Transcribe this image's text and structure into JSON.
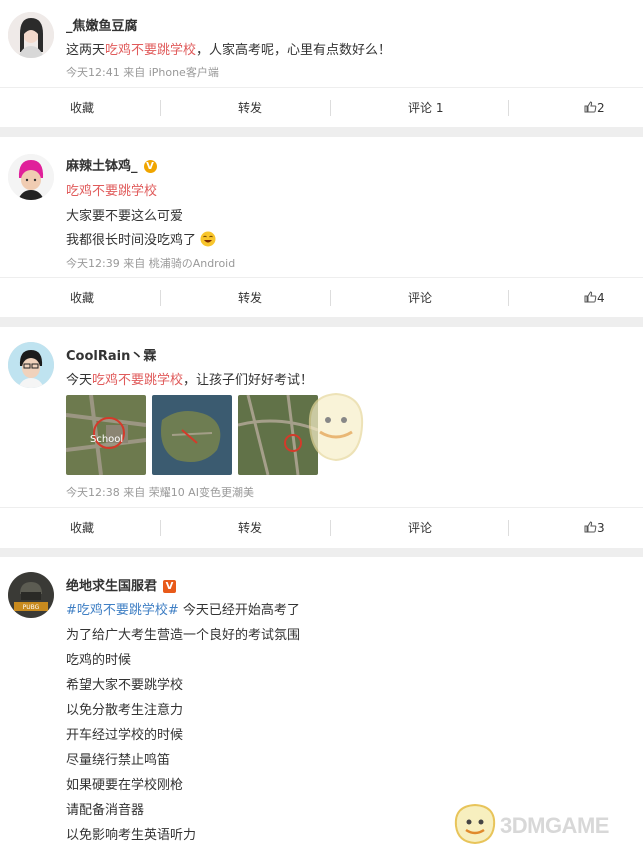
{
  "posts": [
    {
      "username": "_焦嫩鱼豆腐",
      "verified": false,
      "lines": [
        {
          "pre": "这两天",
          "tag": "吃鸡不要跳学校",
          "post": "，人家高考呢，心里有点数好么！"
        }
      ],
      "meta": "今天12:41 来自 iPhone客户端",
      "actions": {
        "collect": "收藏",
        "repost": "转发",
        "comment": "评论 1",
        "like": "2"
      }
    },
    {
      "username": "麻辣土钵鸡_",
      "verified": true,
      "badge_color": "#f0a500",
      "topic": "吃鸡不要跳学校",
      "lines": [
        {
          "text": "大家要不要这么可爱"
        },
        {
          "text": "我都很长时间没吃鸡了"
        }
      ],
      "meta": "今天12:39 来自 桃浦骑のAndroid",
      "actions": {
        "collect": "收藏",
        "repost": "转发",
        "comment": "评论",
        "like": "4"
      }
    },
    {
      "username": "CoolRain丶霖",
      "verified": false,
      "lines": [
        {
          "pre": "今天",
          "tag": "吃鸡不要跳学校",
          "post": "，让孩子们好好考试！"
        }
      ],
      "images": [
        "school-map-thumbnail",
        "island-map-thumbnail",
        "map-route-thumbnail"
      ],
      "map_label": "School",
      "meta": "今天12:38 来自 荣耀10 AI变色更潮美",
      "actions": {
        "collect": "收藏",
        "repost": "转发",
        "comment": "评论",
        "like": "3"
      }
    },
    {
      "username": "绝地求生国服君",
      "verified": true,
      "badge_color": "#e85a1a",
      "topic_line": {
        "tag": "#吃鸡不要跳学校#",
        "post": " 今天已经开始高考了"
      },
      "lines": [
        {
          "text": "为了给广大考生营造一个良好的考试氛围"
        },
        {
          "text": "吃鸡的时候"
        },
        {
          "text": "希望大家不要跳学校"
        },
        {
          "text": "以免分散考生注意力"
        },
        {
          "text": "开车经过学校的时候"
        },
        {
          "text": "尽量绕行禁止鸣笛"
        },
        {
          "text": "如果硬要在学校刚枪"
        },
        {
          "text": "请配备消音器"
        },
        {
          "text": "以免影响考生英语听力"
        }
      ]
    }
  ],
  "watermark": "3DMGAME",
  "colors": {
    "highlight": "#e05b5b",
    "topic_blue": "#3f7fc4",
    "meta": "#999999"
  }
}
